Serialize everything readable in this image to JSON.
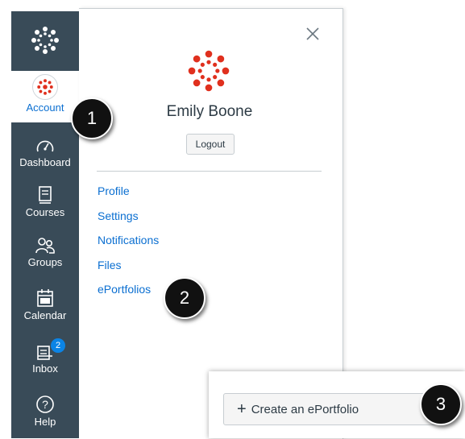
{
  "sidebar": {
    "items": [
      {
        "label": "Account",
        "icon": "user-avatar-icon"
      },
      {
        "label": "Dashboard",
        "icon": "dashboard-gauge-icon"
      },
      {
        "label": "Courses",
        "icon": "book-icon"
      },
      {
        "label": "Groups",
        "icon": "groups-icon"
      },
      {
        "label": "Calendar",
        "icon": "calendar-icon"
      },
      {
        "label": "Inbox",
        "icon": "inbox-icon",
        "badge": "2"
      },
      {
        "label": "Help",
        "icon": "help-icon"
      }
    ]
  },
  "tray": {
    "user_name": "Emily Boone",
    "logout_label": "Logout",
    "links": [
      "Profile",
      "Settings",
      "Notifications",
      "Files",
      "ePortfolios"
    ]
  },
  "create_panel": {
    "button_label": "Create an ePortfolio",
    "plus": "+"
  },
  "callouts": [
    "1",
    "2",
    "3"
  ],
  "colors": {
    "sidebar_bg": "#394b58",
    "link": "#0b6fd1",
    "brand_red": "#e0301e",
    "badge": "#0b84e6"
  }
}
